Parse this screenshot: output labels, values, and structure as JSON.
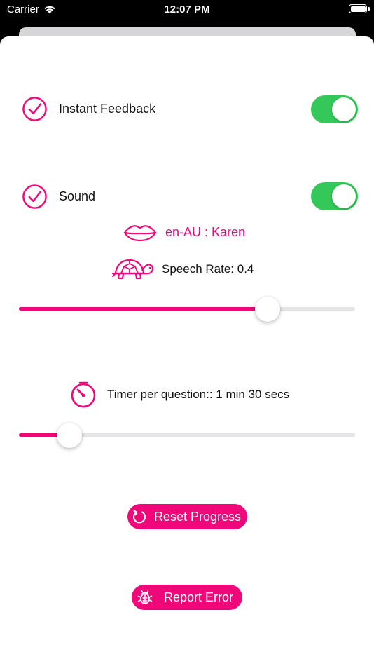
{
  "status_bar": {
    "carrier": "Carrier",
    "time": "12:07 PM"
  },
  "settings": {
    "instant_feedback": {
      "label": "Instant Feedback",
      "enabled": true
    },
    "sound": {
      "label": "Sound",
      "enabled": true
    },
    "voice": {
      "label": "en-AU : Karen"
    },
    "speech_rate": {
      "label": "Speech Rate: 0.4",
      "fraction": 0.74
    },
    "timer": {
      "label": "Timer per question:: 1 min 30 secs",
      "fraction": 0.15
    }
  },
  "buttons": {
    "reset": {
      "label": "Reset Progress"
    },
    "report": {
      "label": "Report Error"
    }
  },
  "icons": {
    "check": "checkmark-circle-icon",
    "lips": "lips-icon",
    "turtle": "turtle-icon",
    "timer": "stopwatch-icon",
    "reset": "refresh-icon",
    "report": "bug-icon",
    "wifi": "wifi-icon",
    "battery": "battery-icon"
  },
  "colors": {
    "accent": "#f0077a",
    "toggle_on": "#34c759",
    "track": "#e4e4e6"
  }
}
